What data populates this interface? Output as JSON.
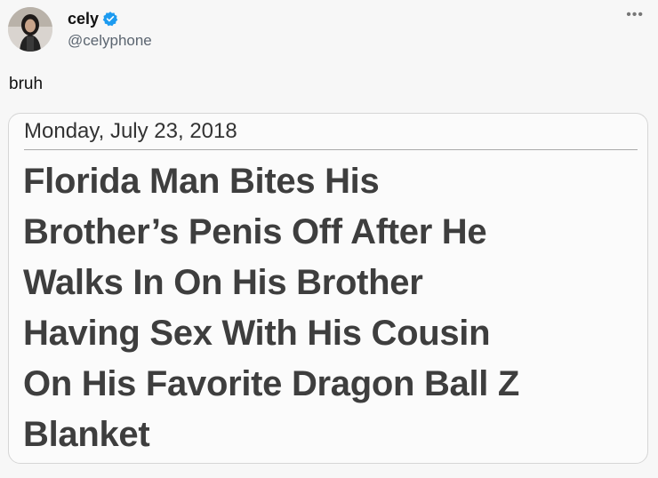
{
  "author": {
    "display_name": "cely",
    "handle": "@celyphone",
    "verified_icon": "verified-badge-icon",
    "avatar": "avatar-photo"
  },
  "menu_icon": "more-options-icon",
  "tweet": {
    "text": "bruh"
  },
  "card": {
    "date": "Monday, July 23, 2018",
    "headline_lines": [
      "Florida Man Bites His",
      "Brother’s Penis Off After He",
      "Walks In On His Brother",
      "Having Sex With His Cousin",
      "On His Favorite Dragon Ball Z",
      "Blanket"
    ]
  },
  "colors": {
    "verified": "#1d9bf0",
    "background": "#f7f7f7",
    "headline": "#3e3e3e"
  }
}
